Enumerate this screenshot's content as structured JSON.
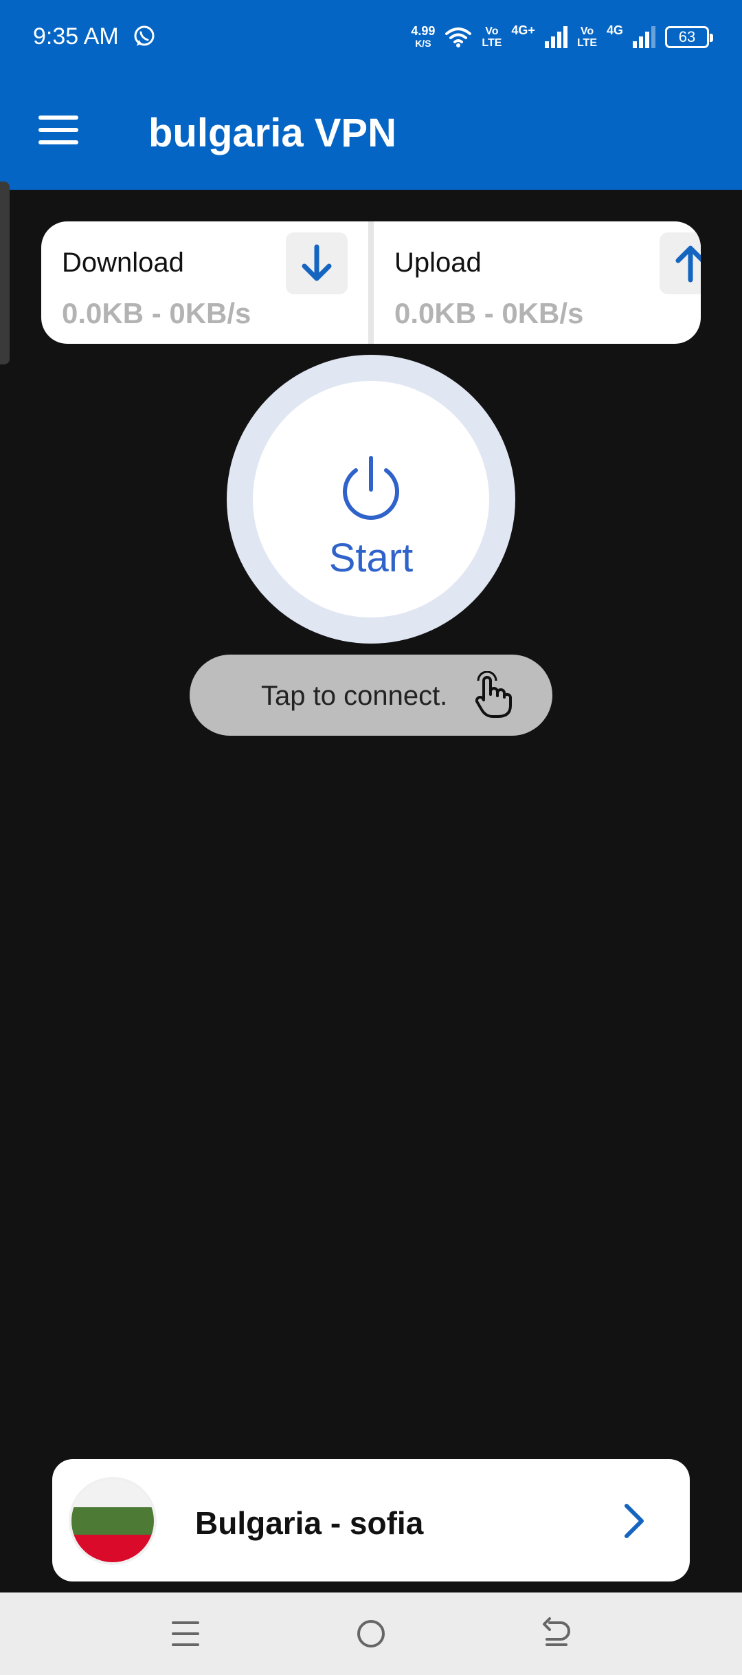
{
  "status_bar": {
    "time": "9:35 AM",
    "net_speed": "4.99",
    "net_speed_unit": "K/S",
    "volte1_top": "Vo",
    "volte1_bottom": "LTE",
    "net1": "4G+",
    "volte2_top": "Vo",
    "volte2_bottom": "LTE",
    "net2": "4G",
    "battery": "63",
    "icons": [
      "whatsapp-icon",
      "wifi-icon",
      "signal-icon",
      "battery-icon"
    ]
  },
  "app_bar": {
    "title": "bulgaria VPN",
    "menu_icon": "hamburger-menu-icon"
  },
  "stats": {
    "download": {
      "label": "Download",
      "value": "0.0KB - 0KB/s",
      "icon": "arrow-down-icon"
    },
    "upload": {
      "label": "Upload",
      "value": "0.0KB - 0KB/s",
      "icon": "arrow-up-icon"
    }
  },
  "power": {
    "label": "Start",
    "icon": "power-icon"
  },
  "toast": {
    "text": "Tap to connect.",
    "icon": "hand-tap-icon"
  },
  "server": {
    "name": "Bulgaria - sofia",
    "flag_colors": [
      "#f2f2f2",
      "#4d7a35",
      "#d90a2a"
    ],
    "icon": "chevron-right-icon"
  },
  "nav_bar": {
    "icons": [
      "recents-icon",
      "home-icon",
      "back-icon"
    ]
  },
  "colors": {
    "primary": "#0565c4",
    "accent": "#2f63c9",
    "background": "#121212"
  }
}
